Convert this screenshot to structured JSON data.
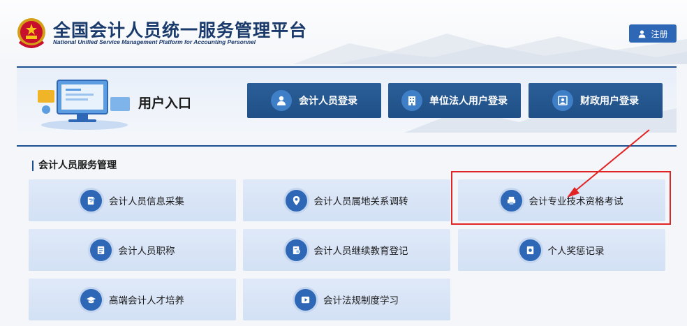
{
  "header": {
    "title": "全国会计人员统一服务管理平台",
    "subtitle": "National Unified Service Management Platform for Accounting Personnel",
    "register_label": "注册"
  },
  "entry": {
    "title": "用户入口",
    "buttons": [
      {
        "label": "会计人员登录",
        "icon": "user-icon"
      },
      {
        "label": "单位法人用户登录",
        "icon": "building-icon"
      },
      {
        "label": "财政用户登录",
        "icon": "portrait-icon"
      }
    ]
  },
  "services": {
    "title": "会计人员服务管理",
    "tiles": [
      {
        "label": "会计人员信息采集",
        "icon": "edit-doc-icon"
      },
      {
        "label": "会计人员属地关系调转",
        "icon": "location-icon"
      },
      {
        "label": "会计专业技术资格考试",
        "icon": "printer-icon"
      },
      {
        "label": "会计人员职称",
        "icon": "certificate-icon"
      },
      {
        "label": "会计人员继续教育登记",
        "icon": "search-doc-icon"
      },
      {
        "label": "个人奖惩记录",
        "icon": "record-icon"
      },
      {
        "label": "高端会计人才培养",
        "icon": "graduation-cap-icon"
      },
      {
        "label": "会计法规制度学习",
        "icon": "play-icon"
      }
    ]
  },
  "colors": {
    "primary": "#1f4f86",
    "accent": "#2e67b6",
    "tile_bg": "#d9e5f6",
    "highlight": "#e02424"
  }
}
